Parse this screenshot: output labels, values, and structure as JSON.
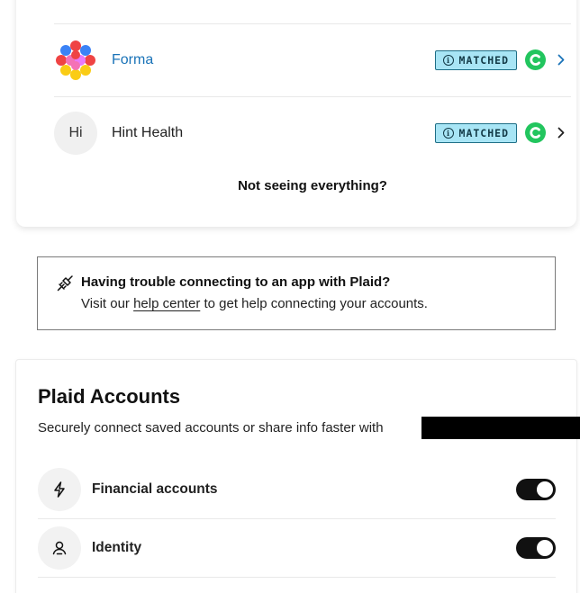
{
  "apps": [
    {
      "name": "Forma",
      "logo": "forma-flower-logo",
      "badge": "MATCHED",
      "badge_icon": "info-icon",
      "status_icon": "c-logo-icon",
      "chevron": "chevron-right-icon",
      "name_color": "#1a73b8"
    },
    {
      "name": "Hint Health",
      "initials": "Hi",
      "badge": "MATCHED",
      "badge_icon": "info-icon",
      "status_icon": "c-logo-icon",
      "chevron": "chevron-right-icon",
      "name_color": "#222222"
    }
  ],
  "not_seeing_link": "Not seeing everything?",
  "trouble": {
    "icon": "plug-icon",
    "title": "Having trouble connecting to an app with Plaid?",
    "text_before": "Visit our ",
    "link": "help center",
    "text_after": " to get help connecting your accounts."
  },
  "plaid_accounts": {
    "title": "Plaid Accounts",
    "subtitle": "Securely connect saved accounts or share info faster with",
    "permissions": [
      {
        "label": "Financial accounts",
        "icon": "lightning-icon",
        "enabled": true
      },
      {
        "label": "Identity",
        "icon": "person-icon",
        "enabled": true
      }
    ]
  },
  "colors": {
    "badge_bg": "#a8e5f5",
    "badge_border": "#1e6e86",
    "status_green": "#22c55e",
    "toggle_on": "#111111",
    "link_blue": "#1a73b8"
  }
}
